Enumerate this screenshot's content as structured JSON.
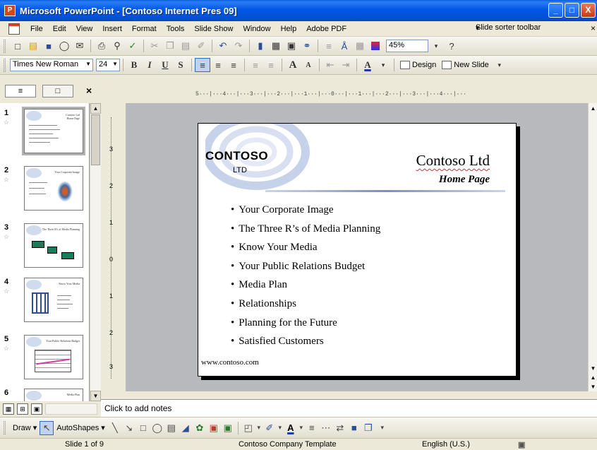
{
  "window": {
    "title": "Microsoft PowerPoint - [Contoso Internet Pres 09]",
    "app_icon": "P",
    "controls": [
      "_",
      "□",
      "X"
    ]
  },
  "menu": {
    "items": [
      "File",
      "Edit",
      "View",
      "Insert",
      "Format",
      "Tools",
      "Slide Show",
      "Window",
      "Help",
      "Adobe PDF"
    ],
    "toolbar_selector": "Slide sorter toolbar",
    "toolbar_selector_arrow": "▾",
    "close_glyph": "×"
  },
  "standard_toolbar": {
    "zoom": "45%",
    "help_glyph": "?"
  },
  "formatting_toolbar": {
    "font": "Times New Roman",
    "size": "24",
    "bold": "B",
    "italic": "I",
    "underline": "U",
    "shadow": "S",
    "increase_font": "A",
    "decrease_font": "A",
    "font_color": "A",
    "design_label": "Design",
    "new_slide_label": "New Slide"
  },
  "pane": {
    "tab_outline": "≡",
    "tab_slides": "□",
    "close": "×",
    "slides": [
      {
        "number": "1",
        "title": "Contoso Ltd Home Page"
      },
      {
        "number": "2",
        "title": "Your Corporate Image"
      },
      {
        "number": "3",
        "title": "The Three R's of Media Planning"
      },
      {
        "number": "4",
        "title": "Know Your Media"
      },
      {
        "number": "5",
        "title": "Your Public Relations Budget"
      },
      {
        "number": "6",
        "title": "Media Plan"
      }
    ]
  },
  "ruler": {
    "horizontal": "5···|···4···|···3···|···2···|···1···|···0···|···1···|···2···|···3···|···4···|···",
    "vertical_marks": [
      "3",
      "2",
      "1",
      "0",
      "1",
      "2",
      "3"
    ]
  },
  "slide": {
    "logo_main": "CONTOSO",
    "logo_sub": "LTD",
    "title": "Contoso Ltd",
    "subtitle": "Home Page",
    "bullets": [
      "Your Corporate Image",
      "The Three R’s of Media Planning",
      "Know Your Media",
      "Your Public Relations Budget",
      "Media Plan",
      "Relationships",
      "Planning for the Future",
      "Satisfied Customers"
    ],
    "footer_url": "www.contoso.com"
  },
  "notes": {
    "placeholder": "Click to add notes"
  },
  "draw_toolbar": {
    "draw_label": "Draw",
    "autoshapes_label": "AutoShapes",
    "dropdown_glyph": "▾"
  },
  "status": {
    "slide": "Slide 1 of 9",
    "template": "Contoso Company Template",
    "language": "English (U.S.)"
  },
  "colors": {
    "titlebar": "#0058e6",
    "chrome": "#ece9d8",
    "edit_bg": "#b8b9bc",
    "swirl": "#c6d2ea"
  }
}
